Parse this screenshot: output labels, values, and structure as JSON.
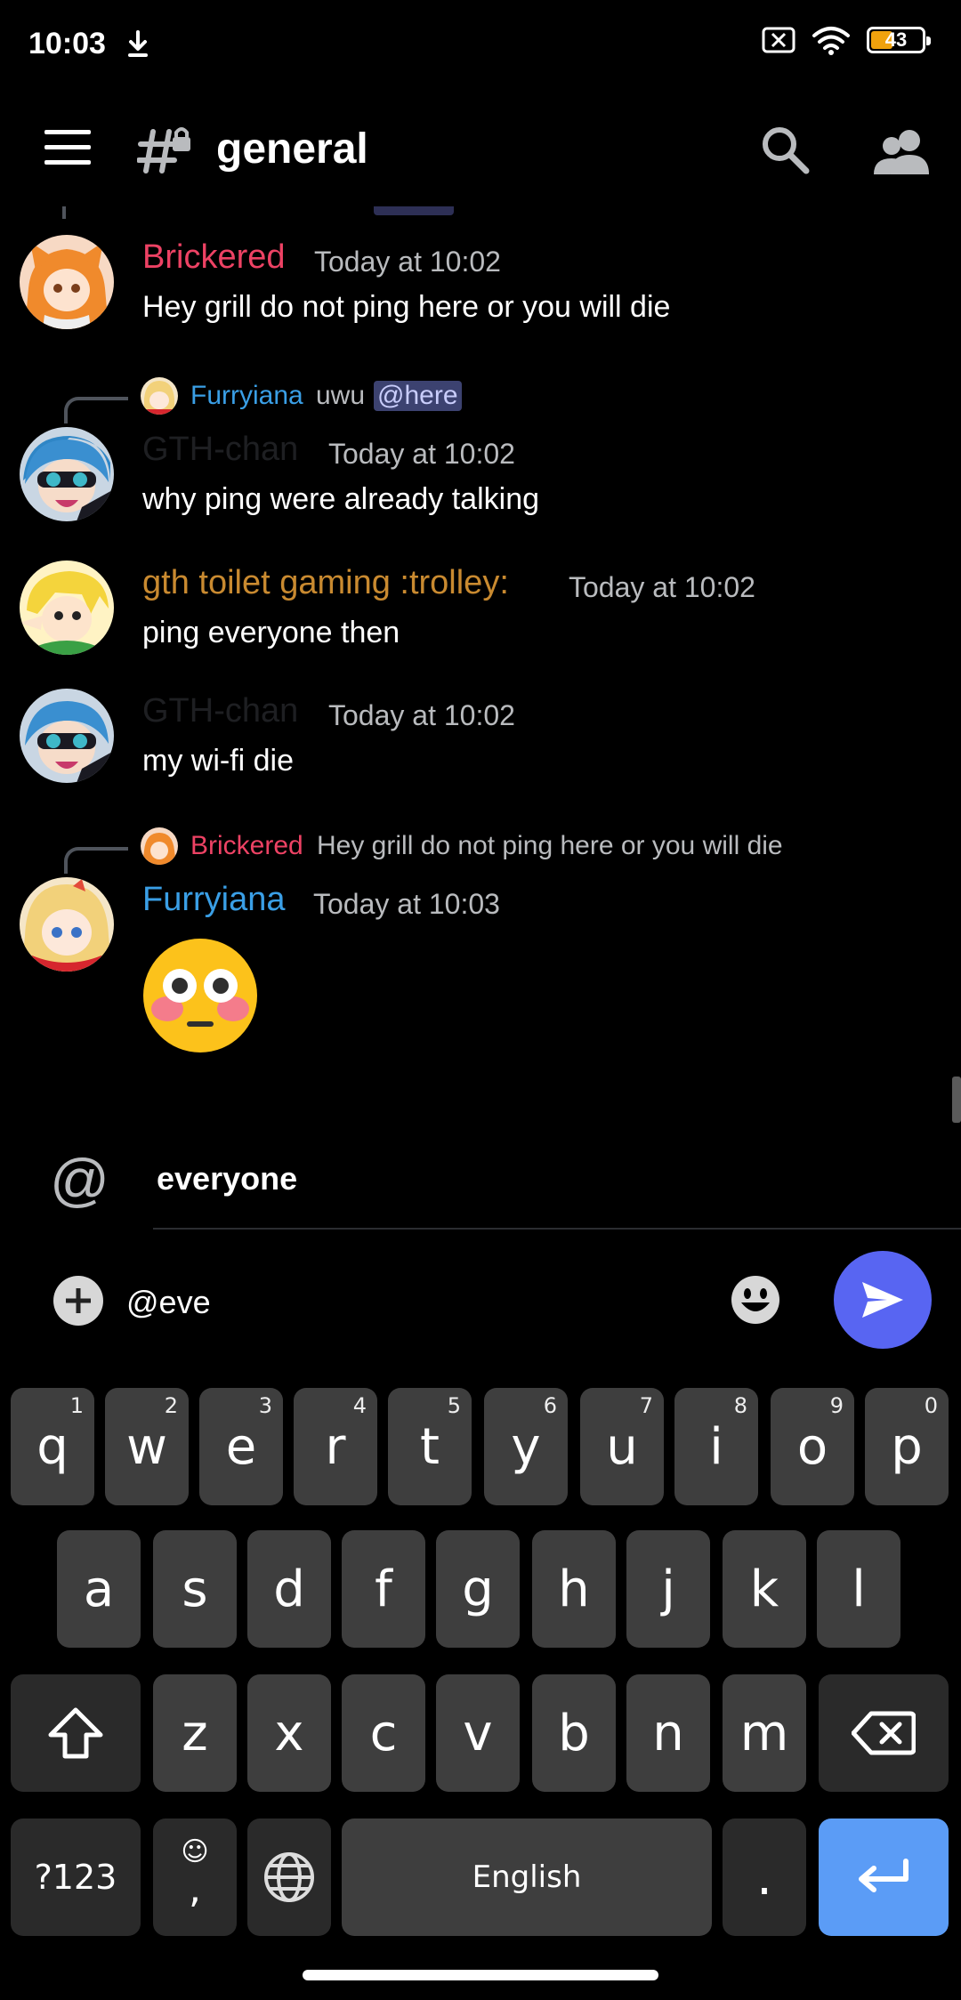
{
  "status_bar": {
    "time": "10:03",
    "battery": "43",
    "battery_level": 0.43
  },
  "header": {
    "channel_name": "general"
  },
  "messages": [
    {
      "author": "Brickered",
      "author_color": "#ed4264",
      "timestamp": "Today at 10:02",
      "text": "Hey grill do not ping here or you will die"
    },
    {
      "reply": {
        "author": "Furryiana",
        "author_color": "#3a9fe6",
        "text": "uwu",
        "mention": "@here"
      },
      "author": "GTH-chan",
      "author_color": "#1e1f22",
      "timestamp": "Today at 10:02",
      "text": "why ping were already talking"
    },
    {
      "author": "gth toilet gaming :trolley:",
      "author_color": "#c98a30",
      "timestamp": "Today at 10:02",
      "text": "ping everyone then"
    },
    {
      "author": "GTH-chan",
      "author_color": "#1e1f22",
      "timestamp": "Today at 10:02",
      "text": "my wi-fi die"
    },
    {
      "reply": {
        "author": "Brickered",
        "author_color": "#ed4264",
        "text": "Hey grill do not ping here or you will die"
      },
      "author": "Furryiana",
      "author_color": "#3a9fe6",
      "timestamp": "Today at 10:03",
      "emoji": "flushed-face"
    }
  ],
  "autocomplete": {
    "symbol": "@",
    "item": "everyone"
  },
  "composer": {
    "value": "@eve"
  },
  "keyboard": {
    "row1": [
      {
        "k": "q",
        "n": "1"
      },
      {
        "k": "w",
        "n": "2"
      },
      {
        "k": "e",
        "n": "3"
      },
      {
        "k": "r",
        "n": "4"
      },
      {
        "k": "t",
        "n": "5"
      },
      {
        "k": "y",
        "n": "6"
      },
      {
        "k": "u",
        "n": "7"
      },
      {
        "k": "i",
        "n": "8"
      },
      {
        "k": "o",
        "n": "9"
      },
      {
        "k": "p",
        "n": "0"
      }
    ],
    "row2": [
      "a",
      "s",
      "d",
      "f",
      "g",
      "h",
      "j",
      "k",
      "l"
    ],
    "row3": [
      "z",
      "x",
      "c",
      "v",
      "b",
      "n",
      "m"
    ],
    "symbols": "?123",
    "comma": ",",
    "space": "English",
    "period": "."
  }
}
